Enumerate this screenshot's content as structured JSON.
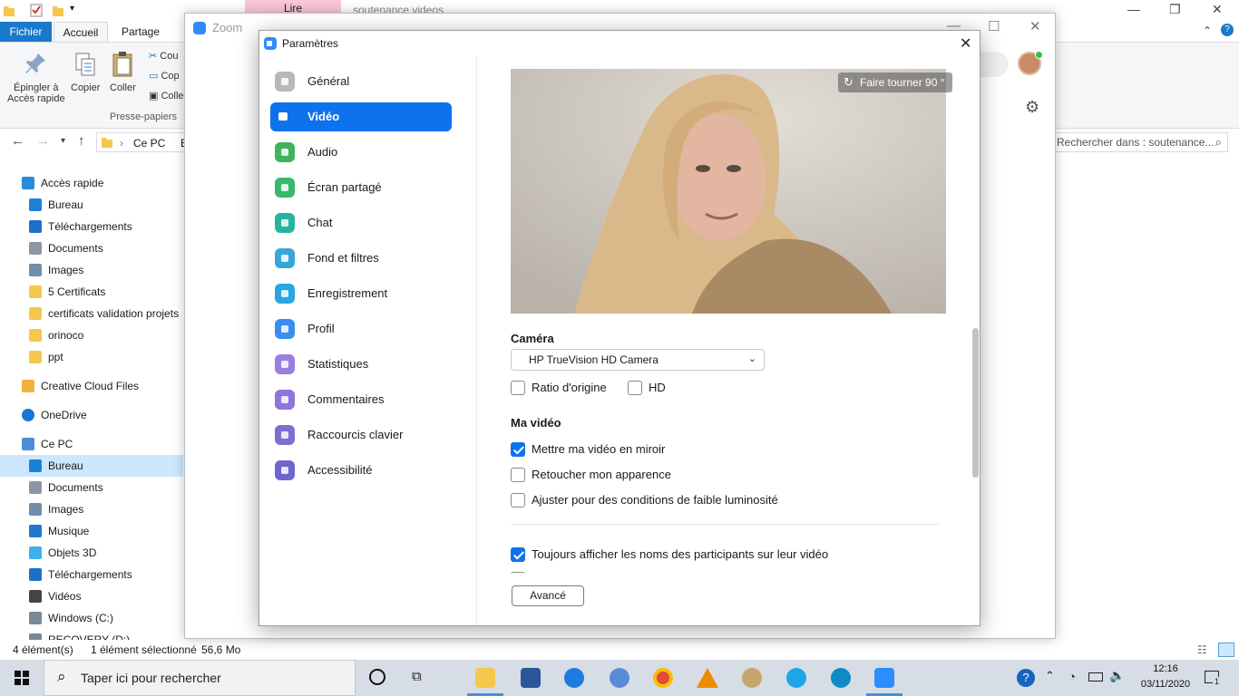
{
  "explorer": {
    "context_tab": "Lire",
    "title": "soutenance videos",
    "tabs": {
      "file": "Fichier",
      "home": "Accueil",
      "share": "Partage"
    },
    "ribbon": {
      "pin_label_1": "Épingler à",
      "pin_label_2": "Accès rapide",
      "copy": "Copier",
      "paste": "Coller",
      "cut_small": "Cou",
      "copy_path_small": "Cop",
      "paste_shortcut_small": "Colle",
      "group_label": "Presse-papiers"
    },
    "address": {
      "path": "Ce PC",
      "path_extra": "B"
    },
    "search_placeholder": "Rechercher dans : soutenance...",
    "nav": [
      {
        "label": "Accès rapide",
        "icon": "star-icon",
        "color": "#2a8bd6",
        "indent": 26
      },
      {
        "label": "Bureau",
        "icon": "desktop-icon",
        "color": "#1a82d6",
        "indent": 34
      },
      {
        "label": "Téléchargements",
        "icon": "download-icon",
        "color": "#1d6fc9",
        "indent": 34
      },
      {
        "label": "Documents",
        "icon": "document-icon",
        "color": "#8a96a4",
        "indent": 34
      },
      {
        "label": "Images",
        "icon": "image-icon",
        "color": "#6e8eaa",
        "indent": 34
      },
      {
        "label": "5 Certificats",
        "icon": "folder-icon",
        "color": "#f5c84c",
        "indent": 34
      },
      {
        "label": "certificats validation projets",
        "icon": "folder-icon",
        "color": "#f5c84c",
        "indent": 34
      },
      {
        "label": "orinoco",
        "icon": "folder-icon",
        "color": "#f5c84c",
        "indent": 34
      },
      {
        "label": "ppt",
        "icon": "folder-icon",
        "color": "#f5c84c",
        "indent": 34
      },
      {
        "label": "Creative Cloud Files",
        "icon": "creative-cloud-icon",
        "color": "#f0b23c",
        "indent": 26
      },
      {
        "label": "OneDrive",
        "icon": "onedrive-icon",
        "color": "#1976d2",
        "indent": 26
      },
      {
        "label": "Ce PC",
        "icon": "computer-icon",
        "color": "#4c8fd6",
        "indent": 26
      },
      {
        "label": "Bureau",
        "icon": "desktop-icon",
        "color": "#1a82d6",
        "indent": 34,
        "selected": true
      },
      {
        "label": "Documents",
        "icon": "document-icon",
        "color": "#8a96a4",
        "indent": 34
      },
      {
        "label": "Images",
        "icon": "image-icon",
        "color": "#6e8eaa",
        "indent": 34
      },
      {
        "label": "Musique",
        "icon": "music-icon",
        "color": "#1e78d0",
        "indent": 34
      },
      {
        "label": "Objets 3D",
        "icon": "cube-icon",
        "color": "#3eb2e8",
        "indent": 34
      },
      {
        "label": "Téléchargements",
        "icon": "download-icon",
        "color": "#1d6fc9",
        "indent": 34
      },
      {
        "label": "Vidéos",
        "icon": "film-icon",
        "color": "#444444",
        "indent": 34
      },
      {
        "label": "Windows (C:)",
        "icon": "drive-icon",
        "color": "#7a8794",
        "indent": 34
      },
      {
        "label": "RECOVERY (D:)",
        "icon": "drive-icon",
        "color": "#7a8794",
        "indent": 34
      }
    ],
    "status": {
      "count": "4 élément(s)",
      "selection": "1 élément sélectionné",
      "size": "56,6 Mo"
    }
  },
  "zoom_main": {
    "title": "Zoom"
  },
  "dialog": {
    "title": "Paramètres",
    "sidebar": [
      {
        "label": "Général",
        "icon": "gear-icon",
        "color": "#b8b8b8"
      },
      {
        "label": "Vidéo",
        "icon": "video-camera-icon",
        "color": "#0e72ed",
        "active": true
      },
      {
        "label": "Audio",
        "icon": "headphones-icon",
        "color": "#3cb55e"
      },
      {
        "label": "Écran partagé",
        "icon": "share-screen-icon",
        "color": "#38b86a"
      },
      {
        "label": "Chat",
        "icon": "chat-bubble-icon",
        "color": "#26b4a0"
      },
      {
        "label": "Fond et filtres",
        "icon": "background-icon",
        "color": "#36a8d8"
      },
      {
        "label": "Enregistrement",
        "icon": "record-icon",
        "color": "#2aa6e0"
      },
      {
        "label": "Profil",
        "icon": "profile-icon",
        "color": "#3a8ef0"
      },
      {
        "label": "Statistiques",
        "icon": "statistics-icon",
        "color": "#9b7ee0"
      },
      {
        "label": "Commentaires",
        "icon": "smiley-icon",
        "color": "#8e74dc"
      },
      {
        "label": "Raccourcis clavier",
        "icon": "keyboard-icon",
        "color": "#7b6fd0"
      },
      {
        "label": "Accessibilité",
        "icon": "accessibility-icon",
        "color": "#6e66cc"
      }
    ],
    "rotate_label": "Faire tourner 90 °",
    "camera_heading": "Caméra",
    "camera_selected": "HP TrueVision HD Camera",
    "ratio_label": "Ratio d'origine",
    "ratio_checked": false,
    "hd_label": "HD",
    "hd_checked": false,
    "my_video_heading": "Ma vidéo",
    "mirror_label": "Mettre ma vidéo en miroir",
    "mirror_checked": true,
    "touchup_label": "Retoucher mon apparence",
    "touchup_checked": false,
    "lowlight_label": "Ajuster pour des conditions de faible luminosité",
    "lowlight_checked": false,
    "names_label": "Toujours afficher les noms des participants sur leur vidéo",
    "names_checked": true,
    "advanced_label": "Avancé"
  },
  "taskbar": {
    "search_placeholder": "Taper ici pour rechercher",
    "time": "12:16",
    "date": "03/11/2020",
    "notifications": "1"
  }
}
